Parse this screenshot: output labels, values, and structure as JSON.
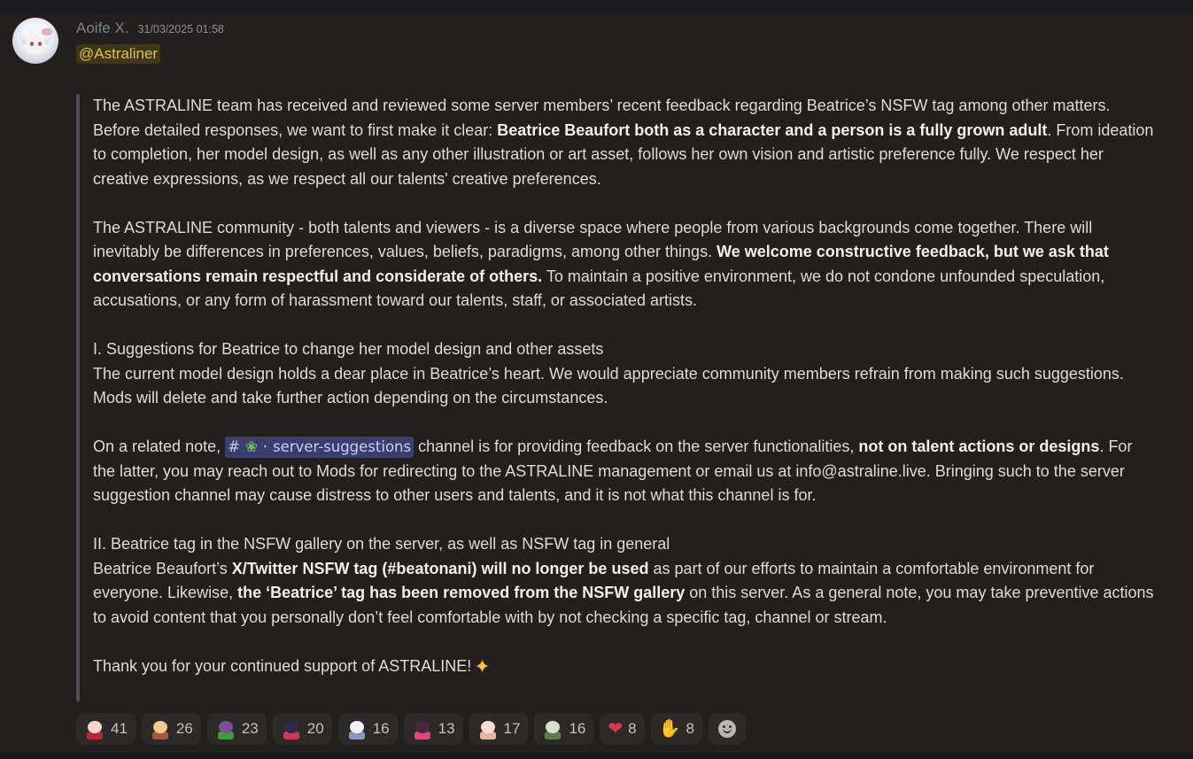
{
  "message": {
    "author": "Aoife X.",
    "timestamp": "31/03/2025 01:58",
    "mention": "@Astraliner"
  },
  "content": {
    "p1_a": "The ASTRALINE team has received and reviewed some server members’ recent feedback regarding Beatrice’s NSFW tag among other matters. Before detailed responses, we want to first make it clear: ",
    "p1_b": "Beatrice Beaufort both as a character and a person is a fully grown adult",
    "p1_c": ". From ideation to completion, her model design, as well as any other illustration or art asset, follows her own vision and artistic preference fully. We respect her creative expressions, as we respect all our talents' creative preferences.",
    "p2_a": "The ASTRALINE community - both talents and viewers - is a diverse space where people from various backgrounds come together. There will inevitably be differences in preferences, values, beliefs, paradigms, among other things. ",
    "p2_b": "We welcome constructive feedback, but we ask that conversations remain respectful and considerate of others.",
    "p2_c": " To maintain a positive environment, we do not condone unfounded speculation, accusations, or any form of harassment toward our talents, staff, or associated artists.",
    "s1_heading": "I. Suggestions for Beatrice to change her model design and other assets",
    "s1_body": "The current model design holds a dear place in Beatrice’s heart. We would appreciate community members refrain from making such suggestions. Mods will delete and take further action depending on the circumstances.",
    "p4_a": "On a related note, ",
    "channel_name": "server-suggestions",
    "p4_b": " channel is for providing feedback on the server functionalities, ",
    "p4_c": "not on talent actions or designs",
    "p4_d": ". For the latter, you may reach out to Mods for redirecting to the ASTRALINE management or email us at info@astraline.live. Bringing such to the server suggestion channel may cause distress to other users and talents, and it is not what this channel is for.",
    "s2_heading": "II. Beatrice tag in the NSFW gallery on the server, as well as NSFW tag in general",
    "s2_a": "Beatrice Beaufort’s ",
    "s2_b": "X/Twitter NSFW tag (#beatonani) will no longer be used",
    "s2_c": " as part of our efforts to maintain a comfortable environment for everyone. Likewise, ",
    "s2_d": "the ‘Beatrice’ tag has been removed from the NSFW gallery",
    "s2_e": " on this server. As a general note, you may take preventive actions to avoid content that you personally don’t feel comfortable with by not checking a specific tag, channel or stream.",
    "closing": "Thank you for your continued support of ASTRALINE!"
  },
  "reactions": [
    {
      "icon": "custom-emoji-1",
      "count": "41",
      "colors": [
        "#f3d6c9",
        "#b5283b"
      ]
    },
    {
      "icon": "custom-emoji-2",
      "count": "26",
      "colors": [
        "#f2c98f",
        "#a3583b"
      ]
    },
    {
      "icon": "custom-emoji-3",
      "count": "23",
      "colors": [
        "#7d4f9a",
        "#3f9b3a"
      ]
    },
    {
      "icon": "custom-emoji-4",
      "count": "20",
      "colors": [
        "#2f2a4a",
        "#c43d55"
      ]
    },
    {
      "icon": "custom-emoji-5",
      "count": "16",
      "colors": [
        "#f1f2f6",
        "#8e96b8"
      ]
    },
    {
      "icon": "custom-emoji-6",
      "count": "13",
      "colors": [
        "#4a2640",
        "#d84b7a"
      ]
    },
    {
      "icon": "custom-emoji-7",
      "count": "17",
      "colors": [
        "#f3ddd0",
        "#e6b39e"
      ]
    },
    {
      "icon": "custom-emoji-8",
      "count": "16",
      "colors": [
        "#d9e0c4",
        "#5f7a4e"
      ]
    },
    {
      "icon": "heart-emoji",
      "count": "8"
    },
    {
      "icon": "thumbs-up-emoji",
      "count": "8"
    }
  ],
  "colors": {
    "background": "#221f1e",
    "mention_bg": "#3d3617",
    "mention_text": "#e0c153",
    "channel_bg": "#3b3d6b",
    "channel_text": "#c9cdfb"
  }
}
